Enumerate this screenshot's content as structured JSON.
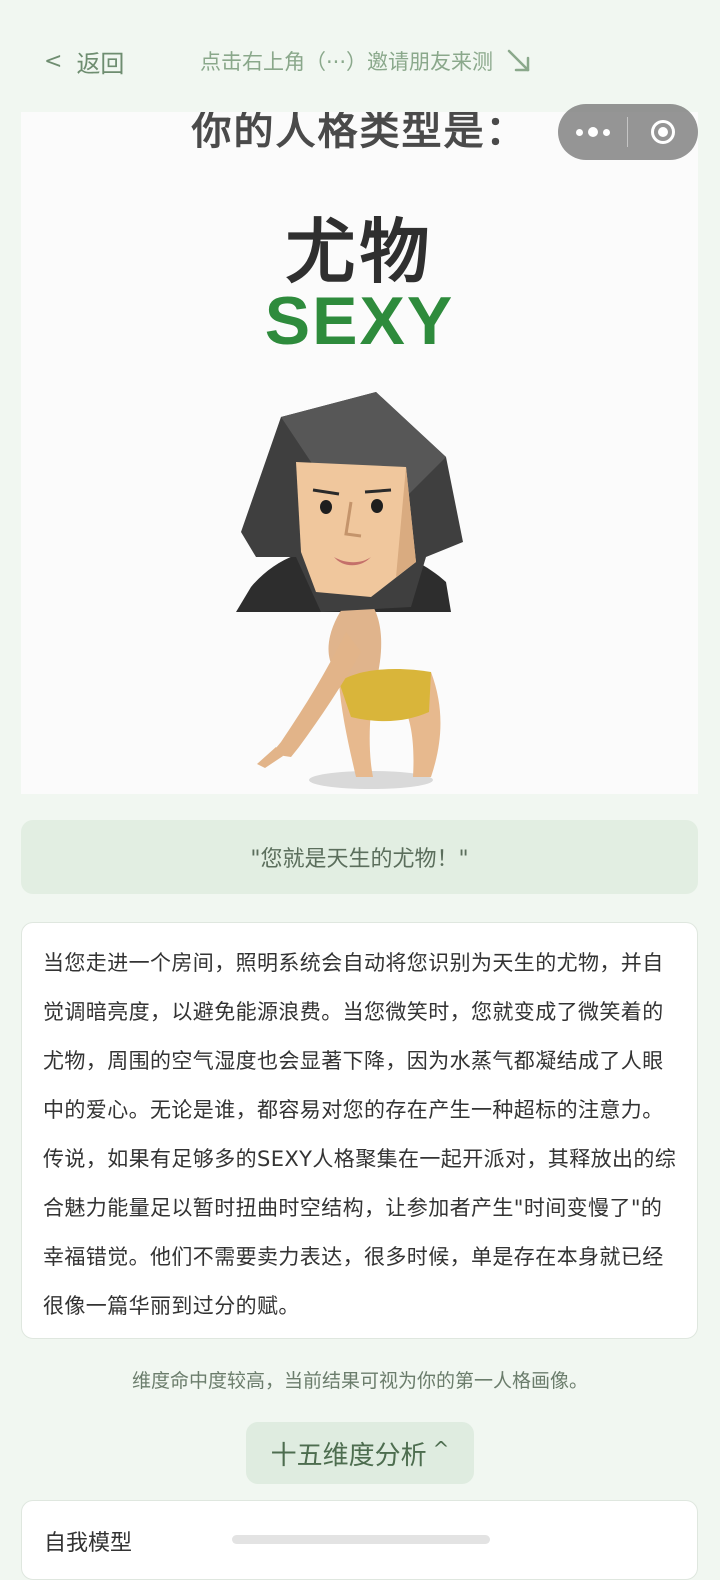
{
  "nav": {
    "back_label": "返回",
    "hint": "点击右上角（···）邀请朋友来测"
  },
  "hero": {
    "cut_title": "你的人格类型是：",
    "type_name": "尤物",
    "type_code": "SEXY"
  },
  "quote": "\"您就是天生的尤物！\"",
  "description": "当您走进一个房间，照明系统会自动将您识别为天生的尤物，并自觉调暗亮度，以避免能源浪费。当您微笑时，您就变成了微笑着的尤物，周围的空气湿度也会显著下降，因为水蒸气都凝结成了人眼中的爱心。无论是谁，都容易对您的存在产生一种超标的注意力。传说，如果有足够多的SEXY人格聚集在一起开派对，其释放出的综合魅力能量足以暂时扭曲时空结构，让参加者产生\"时间变慢了\"的幸福错觉。他们不需要卖力表达，很多时候，单是存在本身就已经很像一篇华丽到过分的赋。",
  "note": "维度命中度较高，当前结果可视为你的第一人格画像。",
  "analysis": {
    "toggle_label": "十五维度分析",
    "toggle_caret": "^",
    "first_dimension": "自我模型"
  },
  "colors": {
    "page_bg": "#f1f7f1",
    "accent_green": "#2e8b3c",
    "quote_bg": "#e2eee2"
  }
}
